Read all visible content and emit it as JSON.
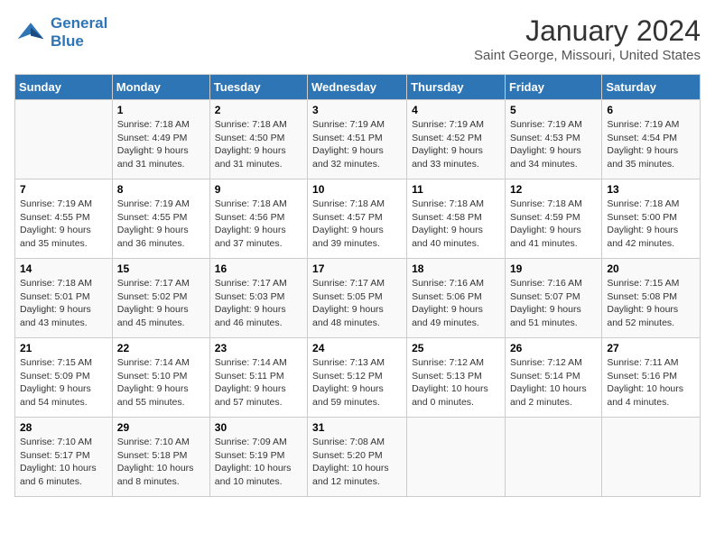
{
  "logo": {
    "line1": "General",
    "line2": "Blue"
  },
  "title": "January 2024",
  "subtitle": "Saint George, Missouri, United States",
  "days_of_week": [
    "Sunday",
    "Monday",
    "Tuesday",
    "Wednesday",
    "Thursday",
    "Friday",
    "Saturday"
  ],
  "weeks": [
    [
      {
        "day": "",
        "sunrise": "",
        "sunset": "",
        "daylight": ""
      },
      {
        "day": "1",
        "sunrise": "Sunrise: 7:18 AM",
        "sunset": "Sunset: 4:49 PM",
        "daylight": "Daylight: 9 hours and 31 minutes."
      },
      {
        "day": "2",
        "sunrise": "Sunrise: 7:18 AM",
        "sunset": "Sunset: 4:50 PM",
        "daylight": "Daylight: 9 hours and 31 minutes."
      },
      {
        "day": "3",
        "sunrise": "Sunrise: 7:19 AM",
        "sunset": "Sunset: 4:51 PM",
        "daylight": "Daylight: 9 hours and 32 minutes."
      },
      {
        "day": "4",
        "sunrise": "Sunrise: 7:19 AM",
        "sunset": "Sunset: 4:52 PM",
        "daylight": "Daylight: 9 hours and 33 minutes."
      },
      {
        "day": "5",
        "sunrise": "Sunrise: 7:19 AM",
        "sunset": "Sunset: 4:53 PM",
        "daylight": "Daylight: 9 hours and 34 minutes."
      },
      {
        "day": "6",
        "sunrise": "Sunrise: 7:19 AM",
        "sunset": "Sunset: 4:54 PM",
        "daylight": "Daylight: 9 hours and 35 minutes."
      }
    ],
    [
      {
        "day": "7",
        "sunrise": "Sunrise: 7:19 AM",
        "sunset": "Sunset: 4:55 PM",
        "daylight": "Daylight: 9 hours and 35 minutes."
      },
      {
        "day": "8",
        "sunrise": "Sunrise: 7:19 AM",
        "sunset": "Sunset: 4:55 PM",
        "daylight": "Daylight: 9 hours and 36 minutes."
      },
      {
        "day": "9",
        "sunrise": "Sunrise: 7:18 AM",
        "sunset": "Sunset: 4:56 PM",
        "daylight": "Daylight: 9 hours and 37 minutes."
      },
      {
        "day": "10",
        "sunrise": "Sunrise: 7:18 AM",
        "sunset": "Sunset: 4:57 PM",
        "daylight": "Daylight: 9 hours and 39 minutes."
      },
      {
        "day": "11",
        "sunrise": "Sunrise: 7:18 AM",
        "sunset": "Sunset: 4:58 PM",
        "daylight": "Daylight: 9 hours and 40 minutes."
      },
      {
        "day": "12",
        "sunrise": "Sunrise: 7:18 AM",
        "sunset": "Sunset: 4:59 PM",
        "daylight": "Daylight: 9 hours and 41 minutes."
      },
      {
        "day": "13",
        "sunrise": "Sunrise: 7:18 AM",
        "sunset": "Sunset: 5:00 PM",
        "daylight": "Daylight: 9 hours and 42 minutes."
      }
    ],
    [
      {
        "day": "14",
        "sunrise": "Sunrise: 7:18 AM",
        "sunset": "Sunset: 5:01 PM",
        "daylight": "Daylight: 9 hours and 43 minutes."
      },
      {
        "day": "15",
        "sunrise": "Sunrise: 7:17 AM",
        "sunset": "Sunset: 5:02 PM",
        "daylight": "Daylight: 9 hours and 45 minutes."
      },
      {
        "day": "16",
        "sunrise": "Sunrise: 7:17 AM",
        "sunset": "Sunset: 5:03 PM",
        "daylight": "Daylight: 9 hours and 46 minutes."
      },
      {
        "day": "17",
        "sunrise": "Sunrise: 7:17 AM",
        "sunset": "Sunset: 5:05 PM",
        "daylight": "Daylight: 9 hours and 48 minutes."
      },
      {
        "day": "18",
        "sunrise": "Sunrise: 7:16 AM",
        "sunset": "Sunset: 5:06 PM",
        "daylight": "Daylight: 9 hours and 49 minutes."
      },
      {
        "day": "19",
        "sunrise": "Sunrise: 7:16 AM",
        "sunset": "Sunset: 5:07 PM",
        "daylight": "Daylight: 9 hours and 51 minutes."
      },
      {
        "day": "20",
        "sunrise": "Sunrise: 7:15 AM",
        "sunset": "Sunset: 5:08 PM",
        "daylight": "Daylight: 9 hours and 52 minutes."
      }
    ],
    [
      {
        "day": "21",
        "sunrise": "Sunrise: 7:15 AM",
        "sunset": "Sunset: 5:09 PM",
        "daylight": "Daylight: 9 hours and 54 minutes."
      },
      {
        "day": "22",
        "sunrise": "Sunrise: 7:14 AM",
        "sunset": "Sunset: 5:10 PM",
        "daylight": "Daylight: 9 hours and 55 minutes."
      },
      {
        "day": "23",
        "sunrise": "Sunrise: 7:14 AM",
        "sunset": "Sunset: 5:11 PM",
        "daylight": "Daylight: 9 hours and 57 minutes."
      },
      {
        "day": "24",
        "sunrise": "Sunrise: 7:13 AM",
        "sunset": "Sunset: 5:12 PM",
        "daylight": "Daylight: 9 hours and 59 minutes."
      },
      {
        "day": "25",
        "sunrise": "Sunrise: 7:12 AM",
        "sunset": "Sunset: 5:13 PM",
        "daylight": "Daylight: 10 hours and 0 minutes."
      },
      {
        "day": "26",
        "sunrise": "Sunrise: 7:12 AM",
        "sunset": "Sunset: 5:14 PM",
        "daylight": "Daylight: 10 hours and 2 minutes."
      },
      {
        "day": "27",
        "sunrise": "Sunrise: 7:11 AM",
        "sunset": "Sunset: 5:16 PM",
        "daylight": "Daylight: 10 hours and 4 minutes."
      }
    ],
    [
      {
        "day": "28",
        "sunrise": "Sunrise: 7:10 AM",
        "sunset": "Sunset: 5:17 PM",
        "daylight": "Daylight: 10 hours and 6 minutes."
      },
      {
        "day": "29",
        "sunrise": "Sunrise: 7:10 AM",
        "sunset": "Sunset: 5:18 PM",
        "daylight": "Daylight: 10 hours and 8 minutes."
      },
      {
        "day": "30",
        "sunrise": "Sunrise: 7:09 AM",
        "sunset": "Sunset: 5:19 PM",
        "daylight": "Daylight: 10 hours and 10 minutes."
      },
      {
        "day": "31",
        "sunrise": "Sunrise: 7:08 AM",
        "sunset": "Sunset: 5:20 PM",
        "daylight": "Daylight: 10 hours and 12 minutes."
      },
      {
        "day": "",
        "sunrise": "",
        "sunset": "",
        "daylight": ""
      },
      {
        "day": "",
        "sunrise": "",
        "sunset": "",
        "daylight": ""
      },
      {
        "day": "",
        "sunrise": "",
        "sunset": "",
        "daylight": ""
      }
    ]
  ]
}
